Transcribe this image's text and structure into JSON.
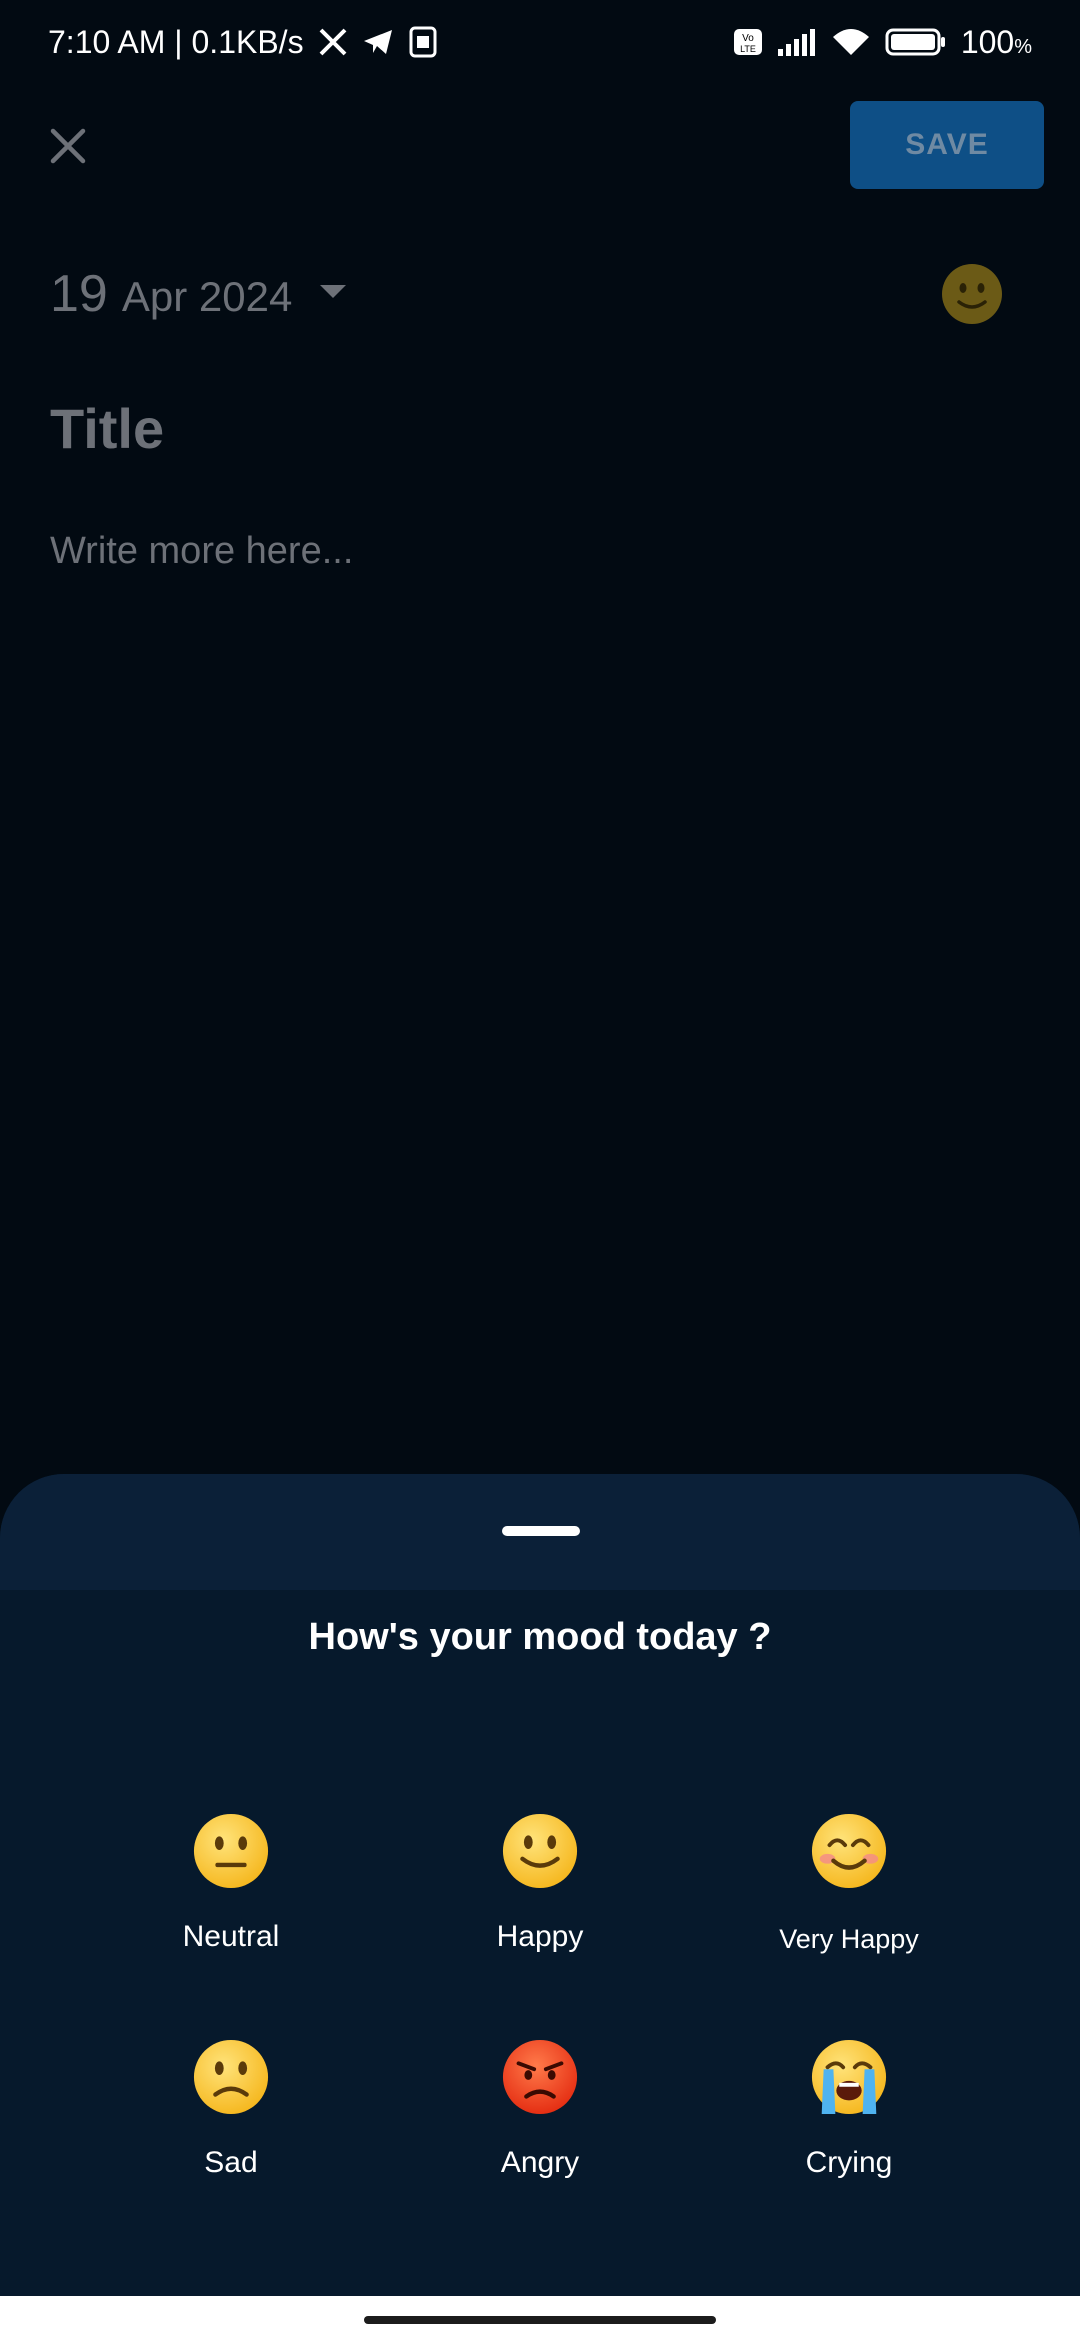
{
  "status_bar": {
    "time_speed": "7:10 AM | 0.1KB/s",
    "battery": "100",
    "battery_unit": "%",
    "icons": [
      "x-app-icon",
      "telegram-icon",
      "sim-icon",
      "volte-icon",
      "signal-icon",
      "wifi-icon",
      "battery-icon"
    ]
  },
  "editor": {
    "save_label": "SAVE",
    "date_day": "19",
    "date_month_year": "Apr 2024",
    "title_placeholder": "Title",
    "body_placeholder": "Write more here...",
    "selected_mood_icon": "slightly-smiling-face-icon"
  },
  "sheet": {
    "title": "How's your mood today ?",
    "moods": [
      {
        "label": "Neutral",
        "icon": "neutral-face-icon"
      },
      {
        "label": "Happy",
        "icon": "slightly-smiling-face-icon"
      },
      {
        "label": "Very Happy",
        "icon": "smiling-face-with-smiling-eyes-icon"
      },
      {
        "label": "Sad",
        "icon": "slightly-frowning-face-icon"
      },
      {
        "label": "Angry",
        "icon": "angry-face-icon"
      },
      {
        "label": "Crying",
        "icon": "loudly-crying-face-icon"
      }
    ]
  },
  "colors": {
    "background": "#020a12",
    "sheet": "#06192c",
    "sheet_header": "#0b2038",
    "save_button": "#0e4f86",
    "placeholder_text": "#6d7178"
  }
}
